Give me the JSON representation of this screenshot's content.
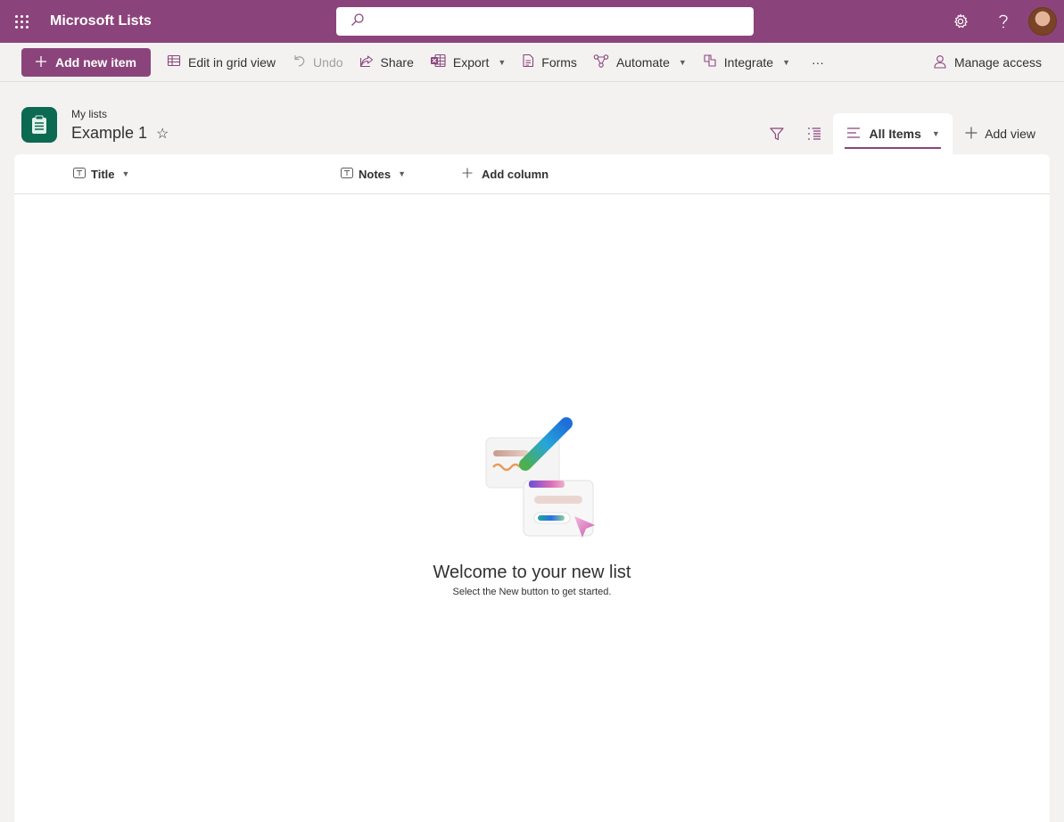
{
  "suite": {
    "app_title": "Microsoft Lists",
    "search_placeholder": "",
    "icons": [
      "waffle-icon",
      "search-icon",
      "settings-icon",
      "help-icon",
      "avatar"
    ]
  },
  "toolbar": {
    "add_new_item": "Add new item",
    "edit_grid": "Edit in grid view",
    "undo": "Undo",
    "share": "Share",
    "export": "Export",
    "forms": "Forms",
    "automate": "Automate",
    "integrate": "Integrate",
    "more": "···",
    "manage_access": "Manage access"
  },
  "list": {
    "breadcrumb": "My lists",
    "title": "Example 1",
    "view_name": "All Items",
    "add_view": "Add view"
  },
  "columns": {
    "title": "Title",
    "notes": "Notes",
    "add_column": "Add column"
  },
  "empty_state": {
    "heading": "Welcome to your new list",
    "subtext": "Select the New button to get started."
  },
  "colors": {
    "brand": "#8b447b",
    "list_icon": "#0b6a51",
    "background": "#f3f2f1"
  }
}
